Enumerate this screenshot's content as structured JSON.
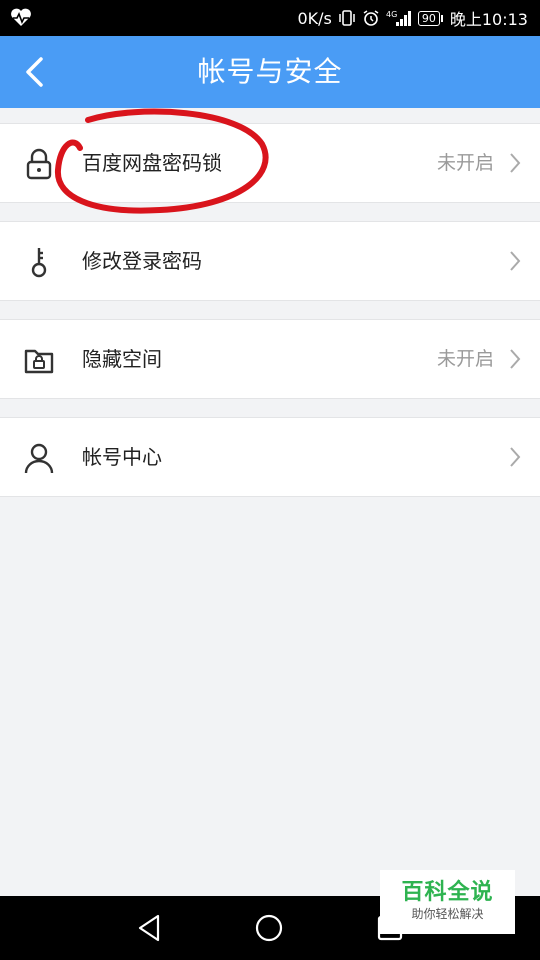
{
  "status_bar": {
    "speed": "0K/s",
    "network": "4G",
    "battery": "90",
    "time": "晚上10:13"
  },
  "header": {
    "title": "帐号与安全"
  },
  "settings": {
    "items": [
      {
        "label": "百度网盘密码锁",
        "status": "未开启",
        "icon": "lock-icon"
      },
      {
        "label": "修改登录密码",
        "status": "",
        "icon": "key-icon"
      },
      {
        "label": "隐藏空间",
        "status": "未开启",
        "icon": "hidden-folder-icon"
      },
      {
        "label": "帐号中心",
        "status": "",
        "icon": "user-icon"
      }
    ]
  },
  "watermark": {
    "title": "百科全说",
    "subtitle": "助你轻松解决"
  },
  "colors": {
    "header": "#4a9cf5",
    "annotation": "#d9141c",
    "watermark_green": "#2eb350"
  }
}
